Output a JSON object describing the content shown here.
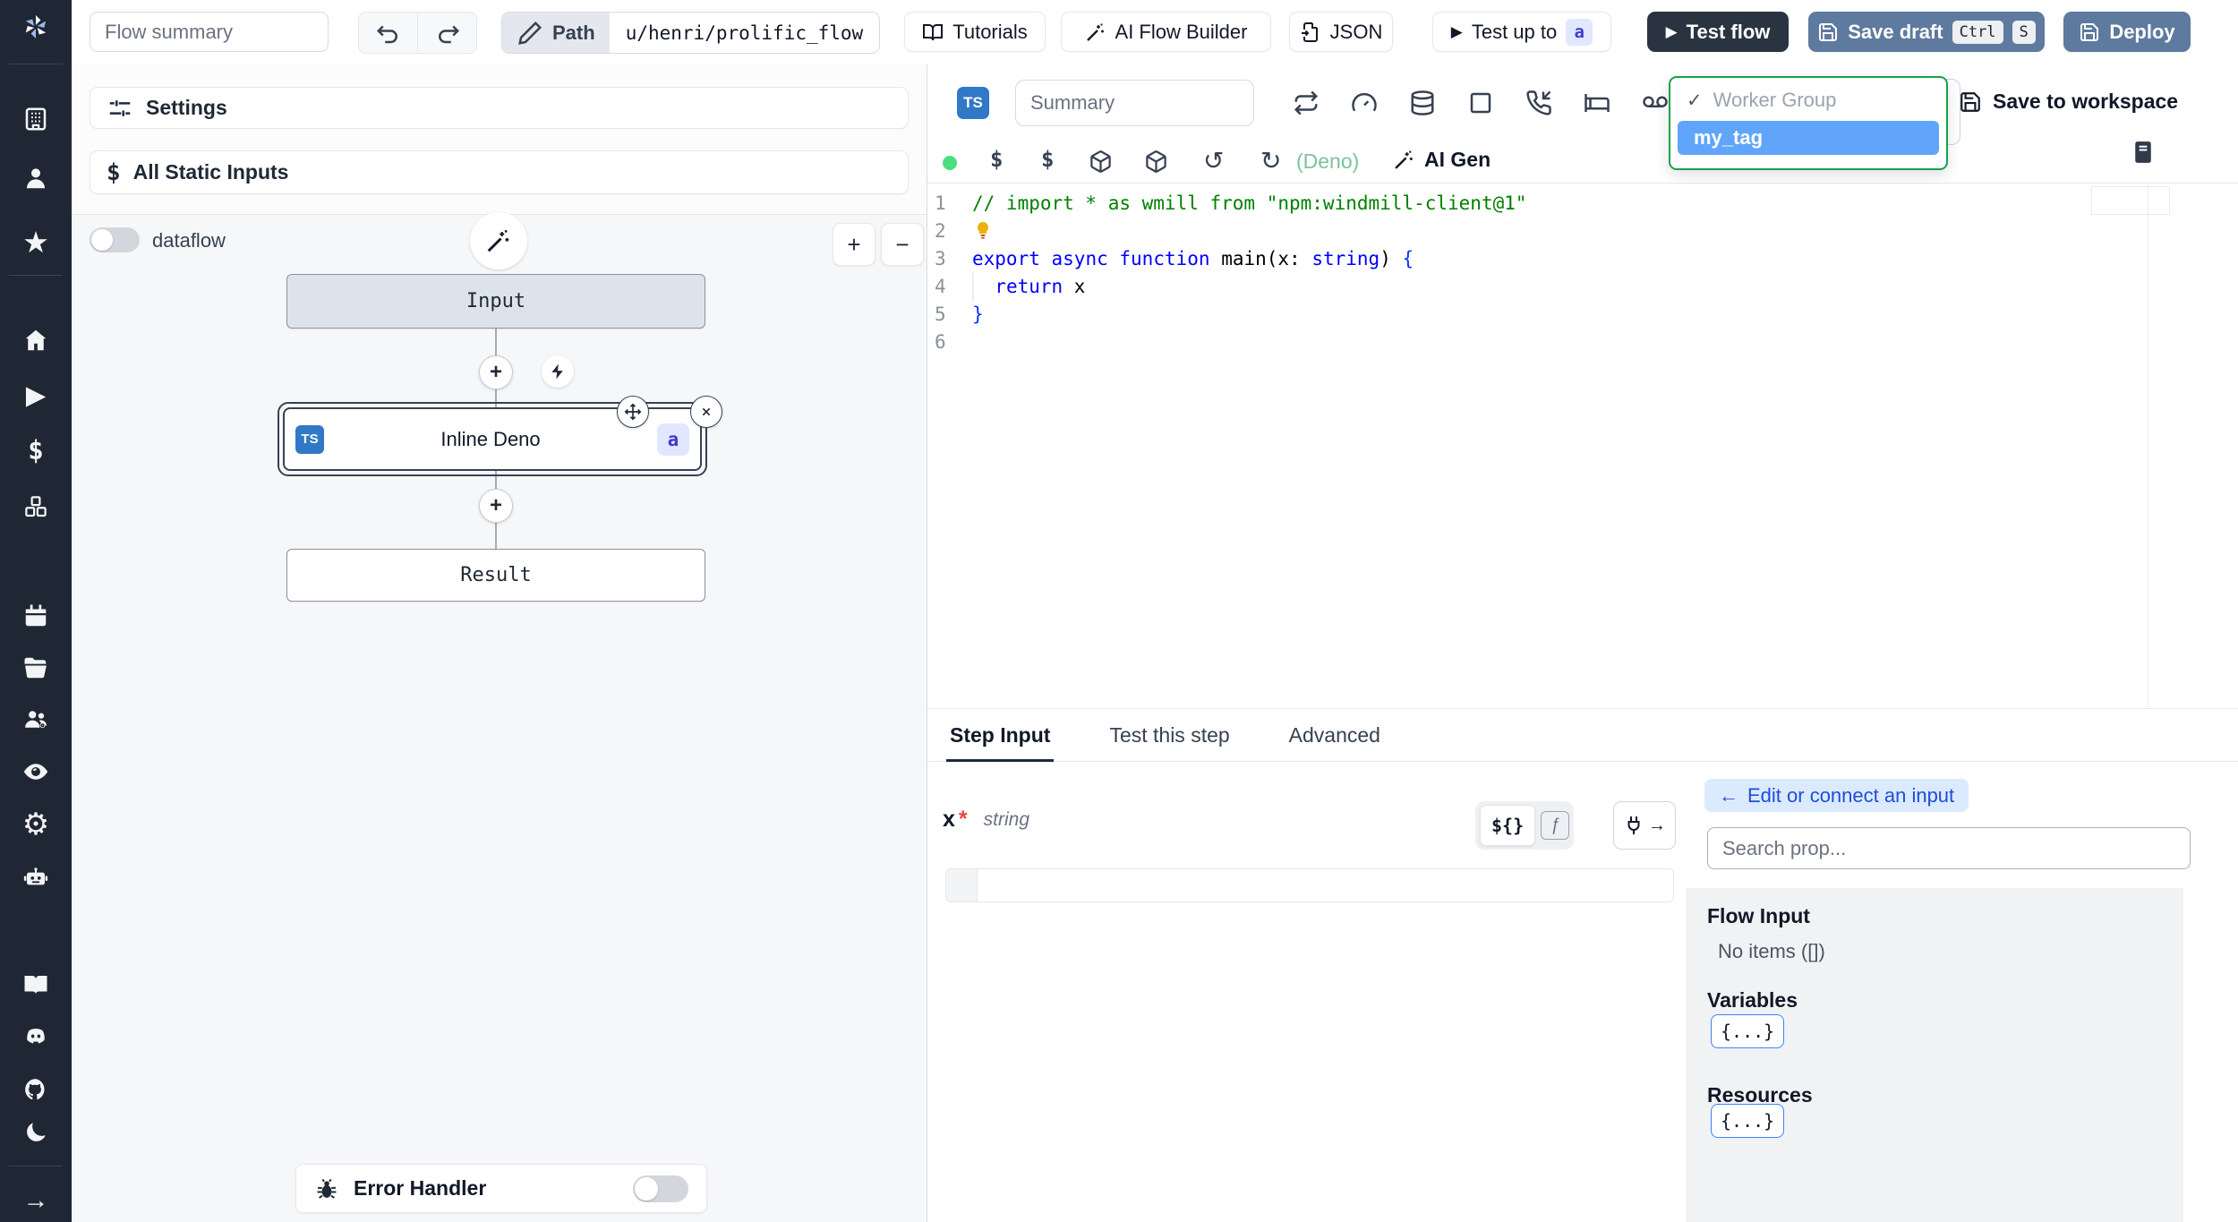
{
  "icons": {
    "play": "▶",
    "plus": "+",
    "minus": "−",
    "dollar": "$",
    "star": "★",
    "gear": "⚙",
    "arrow_right": "→",
    "arrow_left": "←",
    "check": "✓",
    "rotate_ccw": "↺",
    "rotate_cw": "↻"
  },
  "topbar": {
    "flow_summary_placeholder": "Flow summary",
    "path_label": "Path",
    "path_value": "u/henri/prolific_flow",
    "tutorials_label": "Tutorials",
    "ai_flow_builder_label": "AI Flow Builder",
    "json_label": "JSON",
    "test_up_to_label": "Test up to",
    "test_up_to_badge": "a",
    "test_flow_label": "Test flow",
    "save_draft_label": "Save draft",
    "save_draft_shortcut": [
      "Ctrl",
      "S"
    ],
    "deploy_label": "Deploy"
  },
  "flow_panel": {
    "settings_label": "Settings",
    "static_inputs_label": "All Static Inputs",
    "dataflow_label": "dataflow",
    "graph": {
      "input_label": "Input",
      "step_lang": "TS",
      "step_label": "Inline Deno",
      "step_badge": "a",
      "result_label": "Result"
    },
    "error_handler_label": "Error Handler"
  },
  "editor": {
    "lang_badge": "TS",
    "summary_placeholder": "Summary",
    "runtime_label": "(Deno)",
    "ai_gen_label": "AI Gen",
    "save_to_workspace_label": "Save to workspace",
    "worker_group": {
      "label": "Worker Group",
      "selected": "my_tag"
    },
    "code": {
      "lines": [
        {
          "num": "1",
          "tokens": [
            {
              "t": "// import * as wmill from \"npm:windmill-client@1\"",
              "c": "comment"
            }
          ]
        },
        {
          "num": "2",
          "icon": "lightbulb",
          "tokens": []
        },
        {
          "num": "3",
          "tokens": [
            {
              "t": "export",
              "c": "kw"
            },
            {
              "t": " ",
              "c": "pl"
            },
            {
              "t": "async",
              "c": "kw"
            },
            {
              "t": " ",
              "c": "pl"
            },
            {
              "t": "function",
              "c": "kw"
            },
            {
              "t": " main(x: ",
              "c": "pl"
            },
            {
              "t": "string",
              "c": "kw"
            },
            {
              "t": ") ",
              "c": "pl"
            },
            {
              "t": "{",
              "c": "br"
            }
          ]
        },
        {
          "num": "4",
          "tokens": [
            {
              "t": "  ",
              "c": "indent"
            },
            {
              "t": "return",
              "c": "kw"
            },
            {
              "t": " x",
              "c": "pl"
            }
          ]
        },
        {
          "num": "5",
          "tokens": [
            {
              "t": "}",
              "c": "br"
            }
          ]
        },
        {
          "num": "6",
          "tokens": []
        }
      ]
    }
  },
  "tabs": {
    "items": [
      "Step Input",
      "Test this step",
      "Advanced"
    ]
  },
  "step_input": {
    "field_name": "x",
    "required_mark": "*",
    "field_type": "string",
    "expr_label": "${}",
    "fn_label": "ƒ",
    "connect_label": "Edit or connect an input",
    "search_placeholder": "Search prop...",
    "flow_input_title": "Flow Input",
    "flow_input_empty": "No items ([])",
    "variables_title": "Variables",
    "variables_chip": "{...}",
    "resources_title": "Resources",
    "resources_chip": "{...}"
  },
  "colors": {
    "sidebar_bg": "#1f2734",
    "dark_button": "#2a3441",
    "steel_blue_button": "#5e7a9e",
    "accent_green_border": "#16a34a",
    "selected_item_blue": "#60a5fa",
    "badge_bg": "#e0e7ff",
    "badge_text": "#4338ca",
    "ts_badge_blue": "#3178c6",
    "comment_green": "#008000",
    "keyword_blue": "#0000ff",
    "status_dot_green": "#4ade80",
    "connect_chip_bg": "#dbeafe",
    "connect_chip_text": "#1d4ed8"
  }
}
